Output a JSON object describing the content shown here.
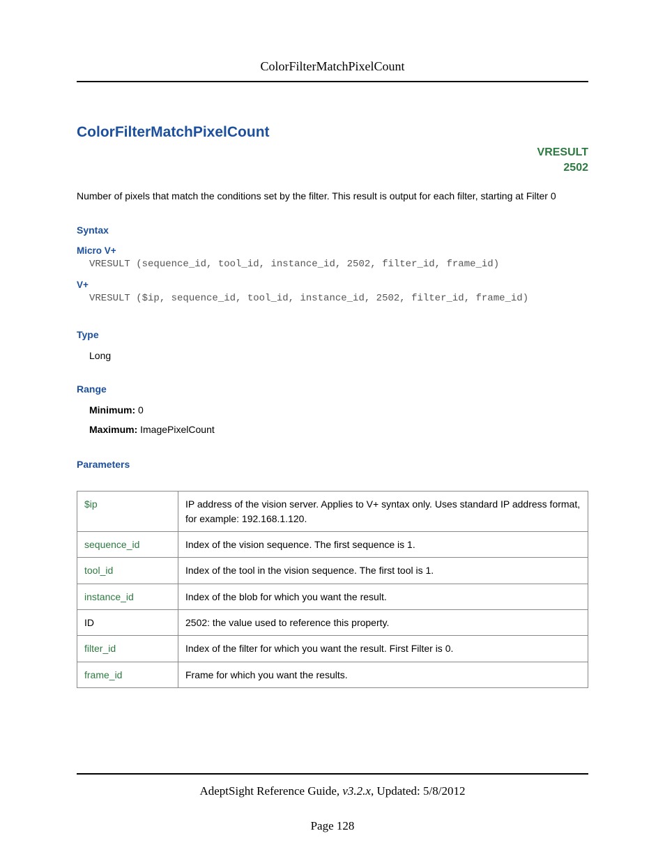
{
  "runningHead": "ColorFilterMatchPixelCount",
  "title": "ColorFilterMatchPixelCount",
  "badge": {
    "line1": "VRESULT",
    "line2": "2502"
  },
  "description": "Number of pixels that match the conditions set by the filter. This result is output for each filter, starting at Filter 0",
  "syntax": {
    "heading": "Syntax",
    "micro": {
      "label": "Micro V+",
      "code": "VRESULT (sequence_id, tool_id, instance_id, 2502, filter_id, frame_id)"
    },
    "vplus": {
      "label": "V+",
      "code": "VRESULT ($ip, sequence_id, tool_id, instance_id, 2502, filter_id, frame_id)"
    }
  },
  "type": {
    "heading": "Type",
    "value": "Long"
  },
  "range": {
    "heading": "Range",
    "minLabel": "Minimum:",
    "minValue": "0",
    "maxLabel": "Maximum:",
    "maxValue": "ImagePixelCount"
  },
  "parameters": {
    "heading": "Parameters",
    "rows": [
      {
        "name": "$ip",
        "desc": "IP address of the vision server. Applies to V+ syntax only. Uses standard IP address format, for example: 192.168.1.120."
      },
      {
        "name": "sequence_id",
        "desc": "Index of the vision sequence. The first sequence is 1."
      },
      {
        "name": "tool_id",
        "desc": "Index of the tool in the vision sequence. The first tool is 1."
      },
      {
        "name": "instance_id",
        "desc": "Index of the blob for which you want the result."
      },
      {
        "name": "ID",
        "desc": "2502: the value used to reference this property."
      },
      {
        "name": "filter_id",
        "desc": "Index of the filter for which you want the result. First Filter is 0."
      },
      {
        "name": "frame_id",
        "desc": "Frame for which you want the results."
      }
    ]
  },
  "footer": {
    "guide": "AdeptSight Reference Guide",
    "versionSep": ", ",
    "version": "v3.2.x",
    "updatedSep": ", ",
    "updatedLabel": "Updated: ",
    "updatedDate": "5/8/2012",
    "pageLabel": "Page 128"
  }
}
